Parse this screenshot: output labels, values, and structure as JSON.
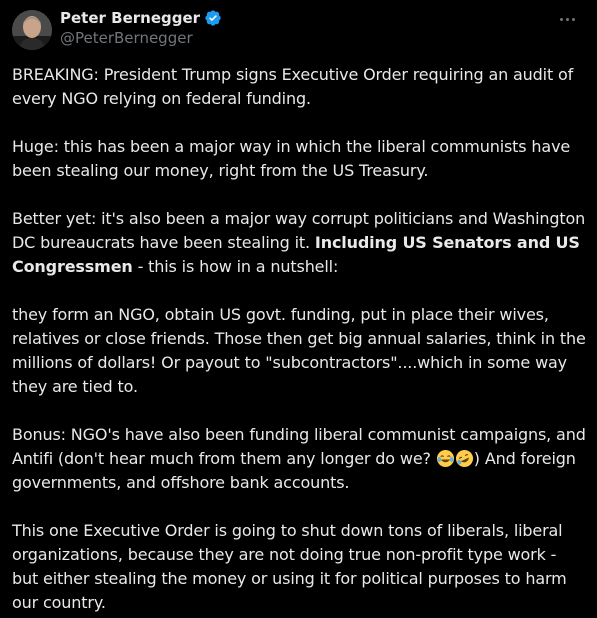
{
  "author": {
    "display_name": "Peter Bernegger",
    "handle": "@PeterBernegger",
    "verified_color": "#1d9bf0"
  },
  "menu": {
    "icon": "more-horizontal-icon"
  },
  "tweet": {
    "p1": "BREAKING:  President Trump signs Executive Order requiring an audit of every NGO relying on federal funding.",
    "p2": "Huge: this has been a major way in which the liberal communists have been stealing our money, right from the US Treasury.",
    "p3_a": "Better yet: it's also been a major way corrupt politicians and Washington DC bureaucrats have been stealing it.  ",
    "p3_bold": "Including US Senators and US Congressmen",
    "p3_b": " - this is how in a nutshell:",
    "p4": "they form an NGO, obtain US govt. funding, put in place their wives, relatives or close friends. Those then get big annual salaries, think in the millions of dollars!  Or payout to \"subcontractors\"....which in some way they are tied to.",
    "p5_a": "Bonus: NGO's have also been funding liberal communist campaigns, and Antifi (don't hear much from them any longer do we?  ",
    "p5_b": ")  And foreign governments, and offshore bank accounts.",
    "p6": "This one Executive Order is going to shut down tons of liberals, liberal organizations, because they are not doing true non-profit type work - but either stealing the money or using it for political purposes to harm our country.",
    "emojis": [
      "tears-of-joy-emoji",
      "rolling-laughing-emoji"
    ]
  }
}
